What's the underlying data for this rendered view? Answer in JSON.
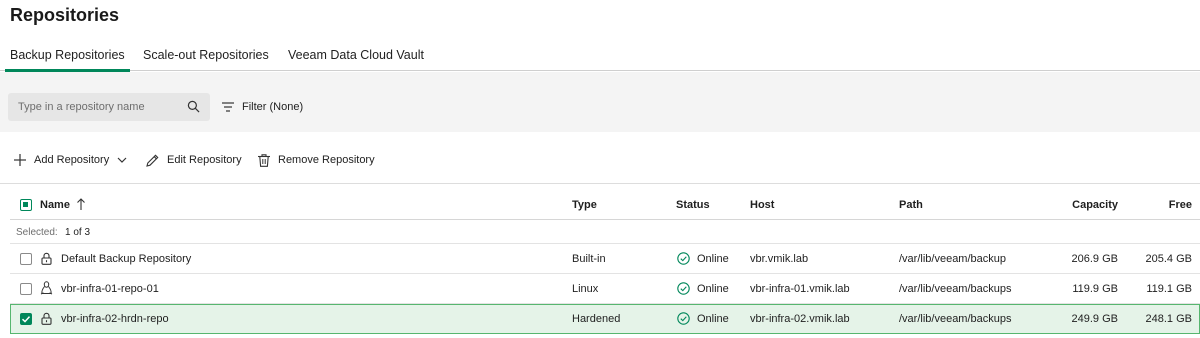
{
  "page": {
    "title": "Repositories"
  },
  "tabs": [
    {
      "label": "Backup Repositories",
      "active": true
    },
    {
      "label": "Scale-out Repositories",
      "active": false
    },
    {
      "label": "Veeam Data Cloud Vault",
      "active": false
    }
  ],
  "search": {
    "placeholder": "Type in a repository name",
    "value": ""
  },
  "filter": {
    "label": "Filter (None)"
  },
  "toolbar": {
    "add_label": "Add Repository",
    "edit_label": "Edit Repository",
    "remove_label": "Remove Repository"
  },
  "table": {
    "columns": {
      "name": "Name",
      "type": "Type",
      "status": "Status",
      "host": "Host",
      "path": "Path",
      "capacity": "Capacity",
      "free": "Free"
    },
    "sort": {
      "column": "name",
      "direction": "ascending"
    },
    "selected_label": "Selected:",
    "selected_value": "1 of 3",
    "rows": [
      {
        "name": "Default Backup Repository",
        "icon": "lock-icon",
        "type": "Built-in",
        "status": "Online",
        "host": "vbr.vmik.lab",
        "path": "/var/lib/veeam/backup",
        "capacity": "206.9 GB",
        "free": "205.4 GB",
        "checked": false
      },
      {
        "name": "vbr-infra-01-repo-01",
        "icon": "linux-icon",
        "type": "Linux",
        "status": "Online",
        "host": "vbr-infra-01.vmik.lab",
        "path": "/var/lib/veeam/backups",
        "capacity": "119.9 GB",
        "free": "119.1 GB",
        "checked": false
      },
      {
        "name": "vbr-infra-02-hrdn-repo",
        "icon": "lock-icon",
        "type": "Hardened",
        "status": "Online",
        "host": "vbr-infra-02.vmik.lab",
        "path": "/var/lib/veeam/backups",
        "capacity": "249.9 GB",
        "free": "248.1 GB",
        "checked": true
      }
    ]
  },
  "colors": {
    "accent": "#00875a",
    "selected_row": "#e5f3e8",
    "selected_border": "#57b66f"
  }
}
